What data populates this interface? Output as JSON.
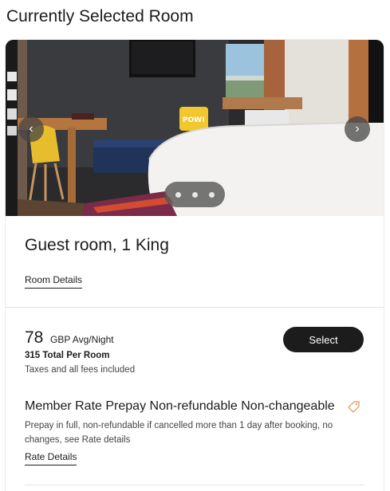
{
  "page": {
    "title": "Currently Selected Room"
  },
  "carousel": {
    "prev_icon": "chevron-left-icon",
    "next_icon": "chevron-right-icon",
    "dot_count": 3,
    "pillow_text": "POW!"
  },
  "room": {
    "name": "Guest room, 1 King",
    "details_link": "Room Details"
  },
  "rate": {
    "amount": "78",
    "unit": "GBP Avg/Night",
    "total": "315 Total Per Room",
    "taxes": "Taxes and all fees included",
    "select_label": "Select",
    "title": "Member Rate Prepay Non-refundable Non-changeable",
    "tag_icon": "tag-icon",
    "description": "Prepay in full, non-refundable if cancelled more than 1 day after booking, no changes, see Rate details",
    "details_link": "Rate Details"
  },
  "colors": {
    "accent_tag": "#e8a06a",
    "button_bg": "#1c1c1c"
  }
}
